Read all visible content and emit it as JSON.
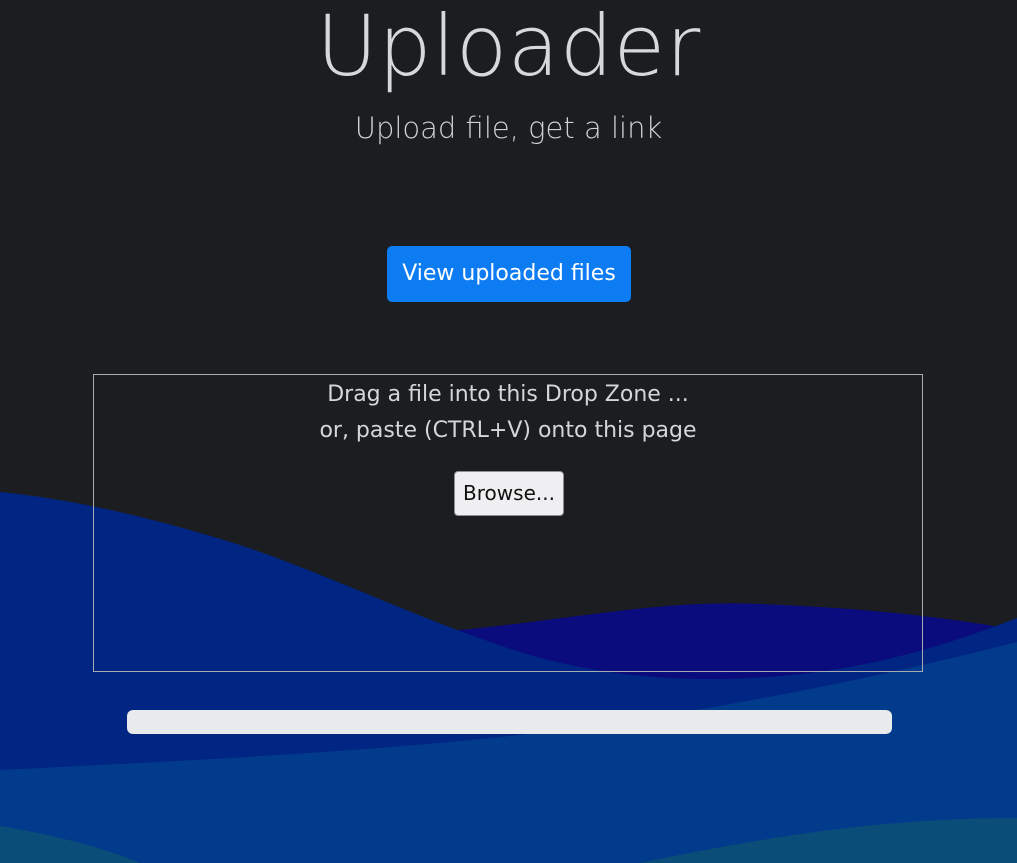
{
  "app": {
    "title": "Uploader",
    "subtitle": "Upload file, get a link"
  },
  "actions": {
    "view_files_label": "View uploaded files"
  },
  "drop_zone": {
    "line1": "Drag a file into this Drop Zone ...",
    "line2": "or, paste (CTRL+V) onto this page",
    "browse_label": "Browse..."
  },
  "upload_progress": {
    "percent": 0
  },
  "colors": {
    "background": "#1b1d21",
    "accent": "#0d7cf2",
    "wave_dark": "#0a0b7c",
    "wave_mid": "#002a80",
    "wave_light": "#003a8c",
    "wave_teal": "#0a4f7a"
  }
}
